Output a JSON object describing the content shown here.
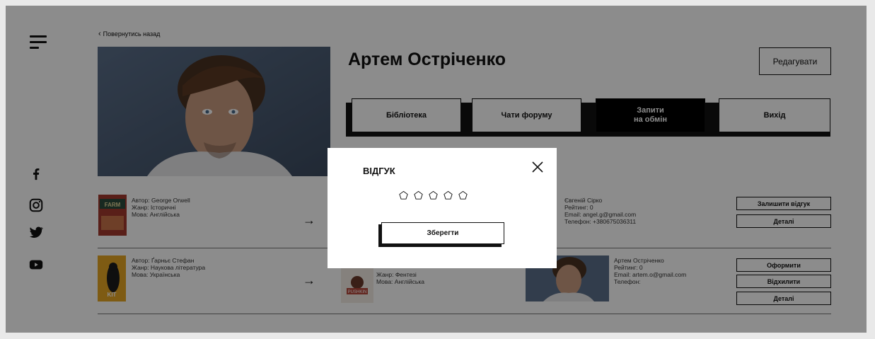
{
  "nav": {
    "back_label": "Повернутись назад"
  },
  "profile": {
    "name": "Артем Остріченко",
    "edit_label": "Редагувати"
  },
  "tabs": [
    {
      "label": "Бібліотека"
    },
    {
      "label": "Чати форуму"
    },
    {
      "label": "Запити",
      "label2": "на обмін",
      "active": true
    },
    {
      "label": "Вихід"
    }
  ],
  "exchanges": [
    {
      "my_book": {
        "author": "Автор: George Orwell",
        "genre": "Жанр: Історичні",
        "language": "Мова: Англійська"
      },
      "user": {
        "name": "Євгеній Сірко",
        "rating": "Рейтинг: 0",
        "email": "Email: angel.g@gmail.com",
        "phone": "Телефон: +380675036311"
      },
      "actions": [
        "Залишити відгук",
        "Деталі"
      ]
    },
    {
      "my_book": {
        "author": "Автор: Ґарньє Стефан",
        "genre": "Жанр: Наукова література",
        "language": "Мова: Українська"
      },
      "their_book": {
        "genre": "Жанр: Фентезі",
        "language": "Мова: Англійська"
      },
      "user": {
        "name": "Артем Остріченко",
        "rating": "Рейтинг: 0",
        "email": "Email: artem.o@gmail.com",
        "phone": "Телефон:"
      },
      "actions": [
        "Оформити",
        "Відхилити",
        "Деталі"
      ]
    }
  ],
  "modal": {
    "title": "ВІДГУК",
    "rating": 0,
    "max_rating": 5,
    "save_label": "Зберегти"
  },
  "icons": [
    "menu-icon",
    "facebook-icon",
    "instagram-icon",
    "twitter-icon",
    "youtube-icon",
    "chevron-left-icon",
    "arrow-right-icon",
    "close-icon",
    "star-icon"
  ]
}
